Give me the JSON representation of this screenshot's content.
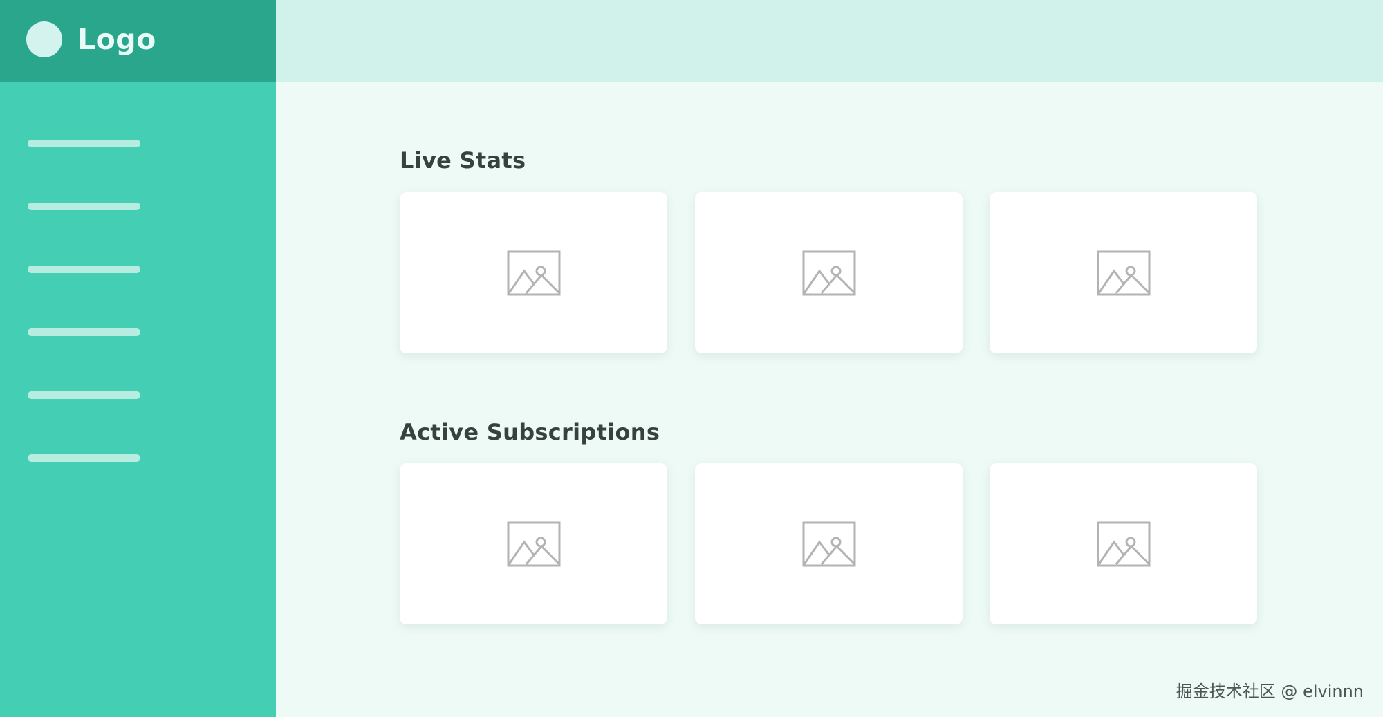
{
  "brand": {
    "logo_text": "Logo"
  },
  "sections": [
    {
      "title": "Live Stats"
    },
    {
      "title": "Active Subscriptions"
    }
  ],
  "cards": {
    "icon": "image-placeholder-icon"
  },
  "watermark": "掘金技术社区 @ elvinnn",
  "colors": {
    "sidebar": "#44cfb5",
    "sidebar_header": "#29a68c",
    "topbar": "#d1f2eb",
    "content_background": "#eefaf6",
    "card": "#ffffff"
  }
}
